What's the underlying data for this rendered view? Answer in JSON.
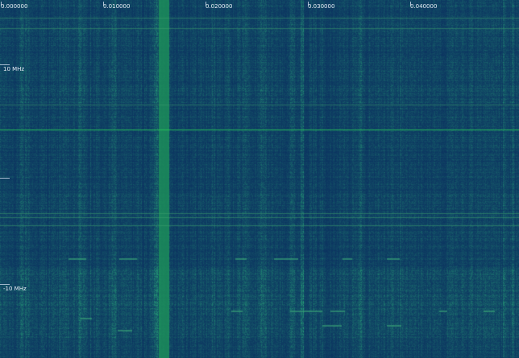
{
  "time_axis": {
    "labels": [
      "0.000000",
      "0.010000",
      "0.020000",
      "0.030000",
      "0.040000"
    ]
  },
  "freq_axis": {
    "top_label": "10 MHz",
    "bottom_label": "-10 MHz"
  },
  "colors": {
    "background": "#0c3160",
    "signal": "#1a9a5c",
    "axis_text": "#e8eef6"
  }
}
